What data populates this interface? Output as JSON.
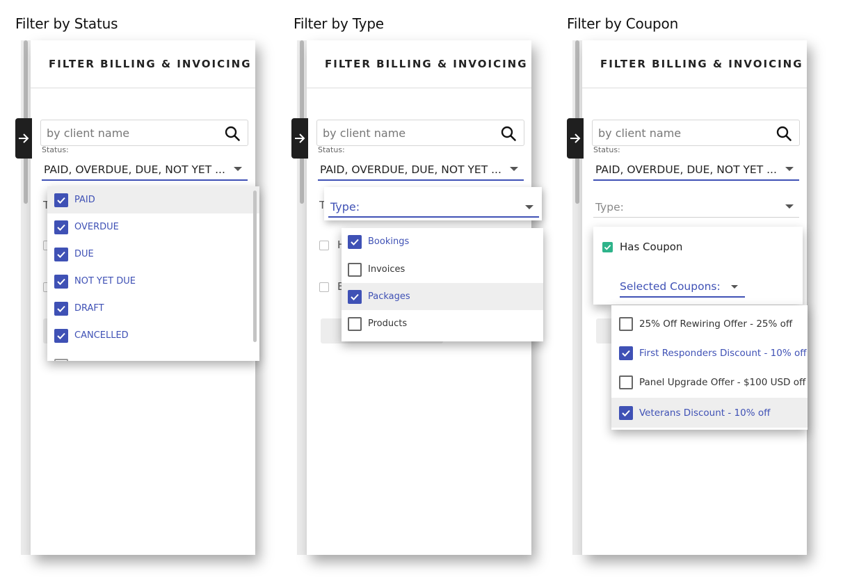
{
  "sections": [
    {
      "title": "Filter by Status"
    },
    {
      "title": "Filter by Type"
    },
    {
      "title": "Filter by Coupon"
    }
  ],
  "panel": {
    "title": "FILTER BILLING & INVOICING",
    "search_placeholder": "by client name",
    "status_label": "Status:",
    "status_value": "PAID, OVERDUE, DUE, NOT YET ...",
    "type_label": "Type:"
  },
  "status_options": [
    {
      "label": "PAID",
      "checked": true
    },
    {
      "label": "OVERDUE",
      "checked": true
    },
    {
      "label": "DUE",
      "checked": true
    },
    {
      "label": "NOT YET DUE",
      "checked": true
    },
    {
      "label": "DRAFT",
      "checked": true
    },
    {
      "label": "CANCELLED",
      "checked": true
    }
  ],
  "type_options": [
    {
      "label": "Bookings",
      "checked": true
    },
    {
      "label": "Invoices",
      "checked": false
    },
    {
      "label": "Packages",
      "checked": true
    },
    {
      "label": "Products",
      "checked": false
    }
  ],
  "coupon": {
    "has_coupon_label": "Has Coupon",
    "selected_coupons_label": "Selected Coupons:",
    "options": [
      {
        "label": "25% Off Rewiring Offer - 25% off",
        "checked": false
      },
      {
        "label": "First Responders Discount - 10% off",
        "checked": true
      },
      {
        "label": "Panel Upgrade Offer - $100 USD off",
        "checked": false
      },
      {
        "label": "Veterans Discount - 10% off",
        "checked": true
      }
    ]
  },
  "ghost_letters": {
    "type_initial": "T",
    "has_initial": "H",
    "bookings_initial": "B"
  },
  "colors": {
    "accent": "#3f51b5",
    "coupon_check": "#2eb38a",
    "header_text": "#222222"
  }
}
